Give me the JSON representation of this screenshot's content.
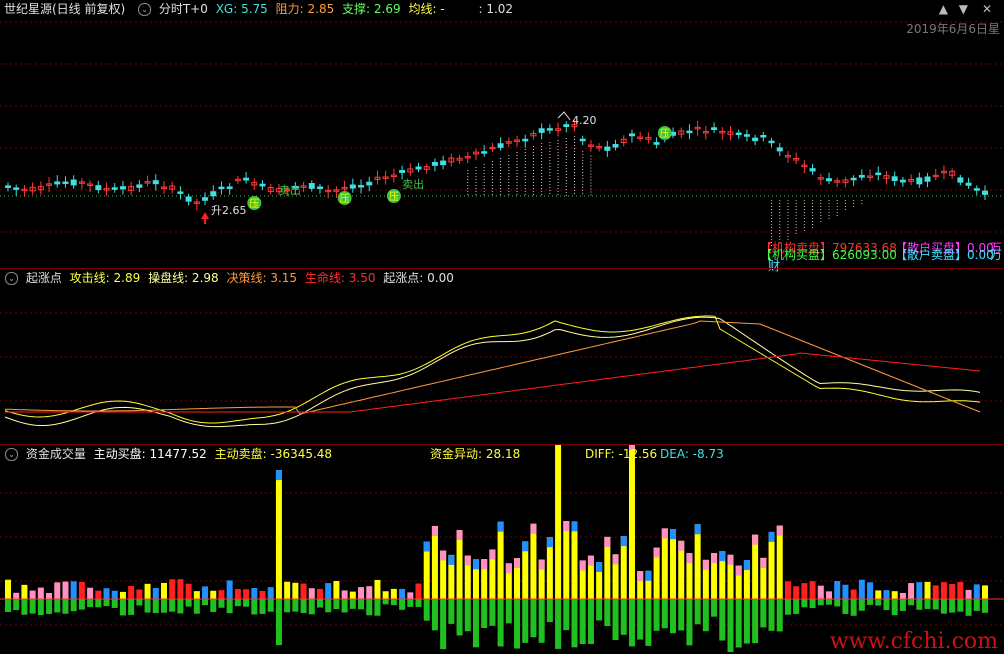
{
  "top_header": {
    "name": "世纪星源(日线 前复权)",
    "indicator": "分时T+0",
    "xg_label": "XG: 5.75",
    "resistance_label": "阻力: 2.85",
    "support_label": "支撑: 2.69",
    "ma_label": "均线: -",
    "ratio_label": ": 1.02",
    "date": "2019年6月6日星"
  },
  "main_annotations": {
    "high_price": "4.20",
    "low_price": "2.65",
    "low_prefix": "升",
    "signals": [
      "压",
      "压",
      "压",
      "压",
      "卖出",
      "卖出",
      "卖出",
      "卖出"
    ],
    "inst_sell": "【机构卖盘】797633.68",
    "retail_buy": "【散户买盘】0.00",
    "inst_buy": "【机构买盘】626093.00",
    "retail_sell": "【散户卖盘】0.00",
    "unit": "万",
    "cai": "财"
  },
  "mid_header": {
    "name": "起涨点",
    "attack": "攻击线: 2.89",
    "operate": "操盘线: 2.98",
    "decision": "决策线: 3.15",
    "life": "生命线: 3.50",
    "start": "起涨点: 0.00"
  },
  "bottom_header": {
    "name": "资金成交量",
    "active_buy": "主动买盘: 11477.52",
    "active_sell": "主动卖盘: -36345.48",
    "fund_move": "资金异动: 28.18",
    "diff": "DIFF: -12.56",
    "dea": "DEA: -8.73"
  },
  "watermark": "www.cfchi.com",
  "colors": {
    "up": "#ff3b3b",
    "down": "#40e0e0",
    "yellow": "#ffff00",
    "orange": "#ff8c00",
    "red": "#ff2020",
    "green": "#20c020",
    "magenta": "#ff40ff",
    "pink": "#ff90c0",
    "blue": "#2090ff"
  }
}
